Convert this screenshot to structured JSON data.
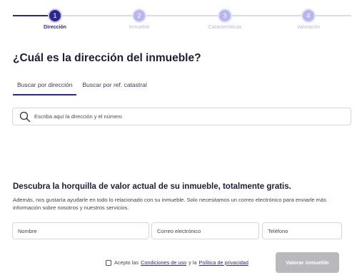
{
  "stepper": {
    "steps": [
      {
        "number": "1",
        "label": "Dirección",
        "state": "active"
      },
      {
        "number": "2",
        "label": "Inmueble",
        "state": "pending"
      },
      {
        "number": "3",
        "label": "Características",
        "state": "pending"
      },
      {
        "number": "4",
        "label": "Valoración",
        "state": "pending"
      }
    ]
  },
  "heading": "¿Cuál es la dirección del inmueble?",
  "tabs": [
    {
      "label": "Buscar por dirección",
      "active": true
    },
    {
      "label": "Buscar por ref. catastral",
      "active": false
    }
  ],
  "search": {
    "placeholder": "Escriba aquí la dirección y el número",
    "value": "",
    "icon": "search-icon"
  },
  "promo": {
    "title": "Descubra la horquilla de valor actual de su inmueble, totalmente gratis.",
    "description": "Además, nos gustaría ayudarle en todo lo relacionado con su inmueble. Solo necesitamos un correo electrónico para enviarle más información sobre nosotros y nuestros servicios."
  },
  "form": {
    "name_placeholder": "Nombre",
    "email_placeholder": "Correo electrónico",
    "phone_placeholder": "Teléfono",
    "consent_prefix": "Acepto las",
    "terms_link": "Condiciones de uso",
    "consent_and": "y la",
    "privacy_link": "Política de privacidad",
    "submit_label": "Valorar inmueble"
  },
  "colors": {
    "primary": "#2b2a8c",
    "inactive_step": "#b7b6f0",
    "disabled_button": "#b9b9bd"
  }
}
